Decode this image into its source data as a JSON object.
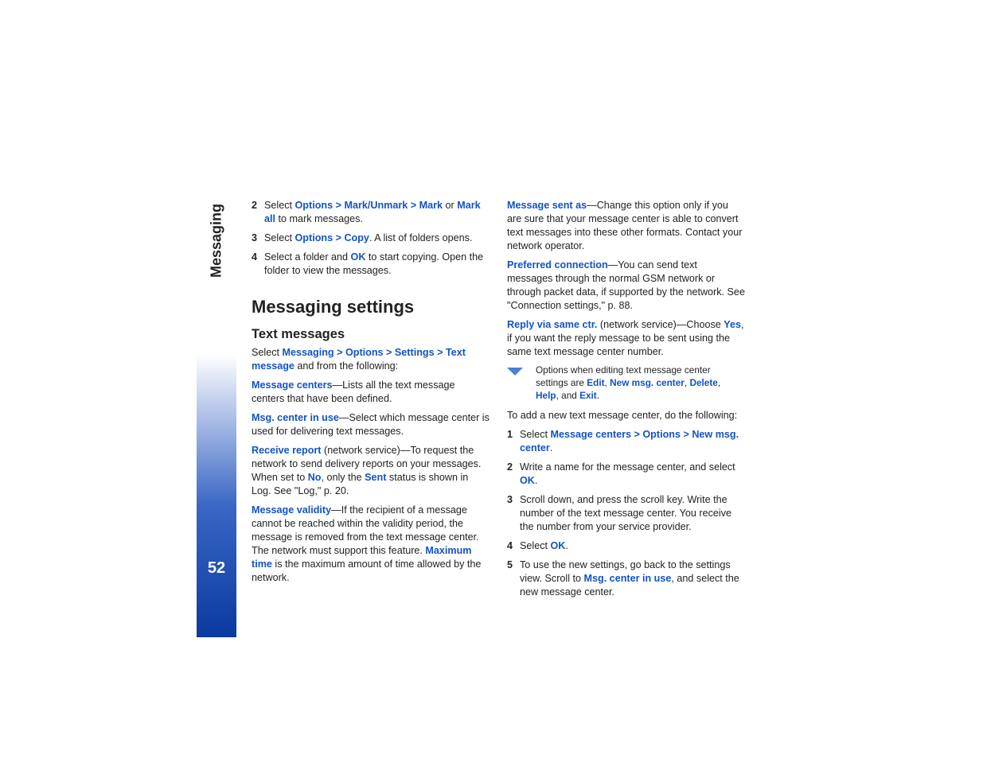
{
  "sidebar": {
    "label": "Messaging",
    "page_number": "52"
  },
  "list1": {
    "i2_num": "2",
    "i2_a": "Select ",
    "i2_b": "Options",
    "i2_c": " > ",
    "i2_d": "Mark/Unmark",
    "i2_e": " > ",
    "i2_f": "Mark",
    "i2_g": " or ",
    "i2_h": "Mark all",
    "i2_i": " to mark messages.",
    "i3_num": "3",
    "i3_a": "Select ",
    "i3_b": "Options",
    "i3_c": " > ",
    "i3_d": "Copy",
    "i3_e": ". A list of folders opens.",
    "i4_num": "4",
    "i4_a": "Select a folder and ",
    "i4_b": "OK",
    "i4_c": " to start copying. Open the folder to view the messages."
  },
  "h1": "Messaging settings",
  "h2": "Text messages",
  "intro": {
    "a": "Select ",
    "b": "Messaging",
    "c": " > ",
    "d": "Options",
    "e": " > ",
    "f": "Settings",
    "g": " > ",
    "h": "Text message",
    "i": " and from the following:"
  },
  "p_mc": {
    "a": "Message centers",
    "b": "—Lists all the text message centers that have been defined."
  },
  "p_mciu": {
    "a": "Msg. center in use",
    "b": "—Select which message center is used for delivering text messages."
  },
  "p_rr": {
    "a": "Receive report",
    "b": " (network service)—To request the network to send delivery reports on your messages. When set to ",
    "c": "No",
    "d": ", only the ",
    "e": "Sent",
    "f": " status is shown in Log. See \"Log,\" p. 20."
  },
  "p_mv": {
    "a": "Message validity",
    "b": "—If the recipient of a message cannot be reached within the validity period, the message is removed from the text message center. The network must support this feature. ",
    "c": "Maximum time",
    "d": " is the maximum amount of time allowed by the network."
  },
  "p_msa": {
    "a": "Message sent as",
    "b": "—Change this option only if you are sure that your message center is able to convert text messages into these other formats. Contact your network operator."
  },
  "p_pc": {
    "a": "Preferred connection",
    "b": "—You can send text messages through the normal GSM network or through packet data, if supported by the network. See \"Connection settings,\" p. 88."
  },
  "p_rvsc": {
    "a": "Reply via same ctr.",
    "b": " (network service)—Choose ",
    "c": "Yes",
    "d": ", if you want the reply message to be sent using the same text message center number."
  },
  "tip": {
    "a": "Options when editing text message center settings are ",
    "b": "Edit",
    "c": ", ",
    "d": "New msg. center",
    "e": ", ",
    "f": "Delete",
    "g": ", ",
    "h": "Help",
    "i": ", and ",
    "j": "Exit",
    "k": "."
  },
  "p_add": "To add a new text message center, do the following:",
  "list2": {
    "i1_num": "1",
    "i1_a": "Select ",
    "i1_b": "Message centers",
    "i1_c": " > ",
    "i1_d": "Options",
    "i1_e": " > ",
    "i1_f": "New msg. center",
    "i1_g": ".",
    "i2_num": "2",
    "i2_a": "Write a name for the message center, and select ",
    "i2_b": "OK",
    "i2_c": ".",
    "i3_num": "3",
    "i3_a": "Scroll down, and press the scroll key. Write the number of the text message center. You receive the number from your service provider.",
    "i4_num": "4",
    "i4_a": "Select ",
    "i4_b": "OK",
    "i4_c": ".",
    "i5_num": "5",
    "i5_a": "To use the new settings, go back to the settings view. Scroll to ",
    "i5_b": "Msg. center in use",
    "i5_c": ", and select the new message center."
  }
}
